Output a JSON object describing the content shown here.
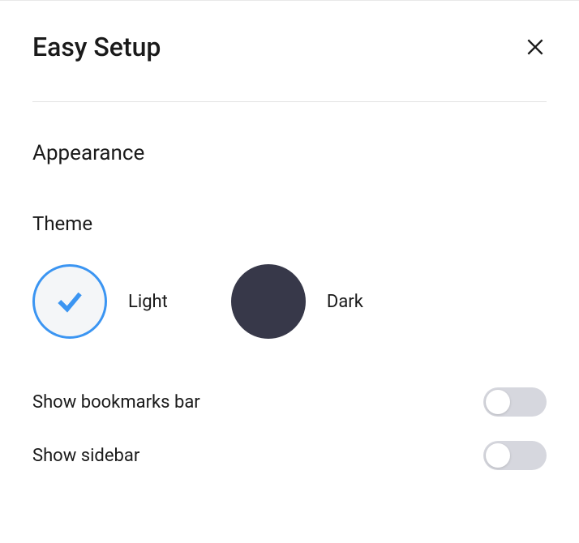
{
  "header": {
    "title": "Easy Setup"
  },
  "appearance": {
    "heading": "Appearance",
    "theme": {
      "heading": "Theme",
      "options": [
        {
          "label": "Light",
          "selected": true
        },
        {
          "label": "Dark",
          "selected": false
        }
      ]
    },
    "toggles": {
      "bookmarks": {
        "label": "Show bookmarks bar",
        "enabled": false
      },
      "sidebar": {
        "label": "Show sidebar",
        "enabled": false
      }
    }
  }
}
